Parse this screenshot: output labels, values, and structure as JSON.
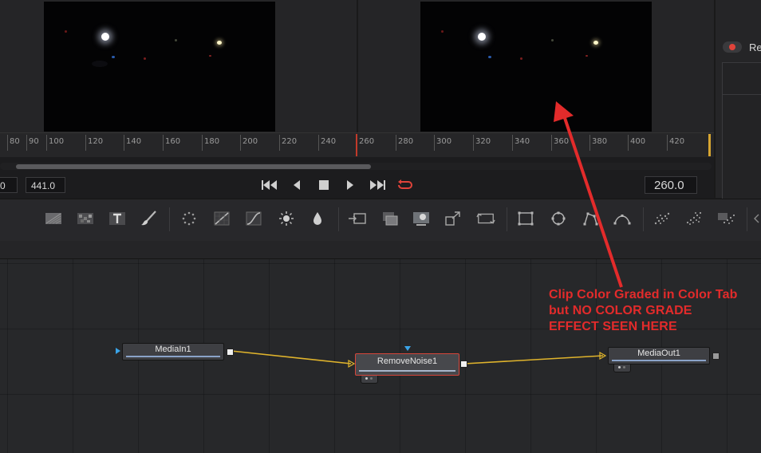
{
  "ruler": {
    "ticks": [
      "80",
      "90",
      "100",
      "120",
      "140",
      "160",
      "180",
      "200",
      "220",
      "240",
      "260",
      "280",
      "300",
      "320",
      "340",
      "360",
      "380",
      "400",
      "420"
    ],
    "playhead_frame": 260
  },
  "transport": {
    "time_start": "0",
    "time_end": "441.0",
    "current_time": "260.0",
    "loop_active": true
  },
  "side_panel": {
    "render_label": "Re"
  },
  "toolbar": {
    "tools": [
      "background-icon",
      "fast-noise-icon",
      "text-icon",
      "paint-icon",
      "particle-emitter-icon",
      "color-curves-icon",
      "brightness-contrast-icon",
      "color-corrector-icon",
      "blur-icon",
      "merge-icon",
      "channel-booleans-icon",
      "matte-control-icon",
      "transform-icon",
      "resize-icon",
      "rectangle-mask-icon",
      "ellipse-mask-icon",
      "polygon-mask-icon",
      "bspline-mask-icon",
      "particle-render-icon",
      "particle-icon",
      "particle-style-icon"
    ]
  },
  "nodes": {
    "media_in": "MediaIn1",
    "remove_noise": "RemoveNoise1",
    "media_out": "MediaOut1"
  },
  "annotation": {
    "line1": "Clip Color Graded in Color Tab",
    "line2": "but NO COLOR GRADE",
    "line3": "EFFECT SEEN HERE",
    "color": "#e32b2b"
  },
  "colors": {
    "playhead": "#c23a2a",
    "selected_node_outline": "#d6453a",
    "connection_line": "#e0b42c",
    "input_arrow": "#3aa4e8",
    "loop_icon": "#e0433a"
  }
}
